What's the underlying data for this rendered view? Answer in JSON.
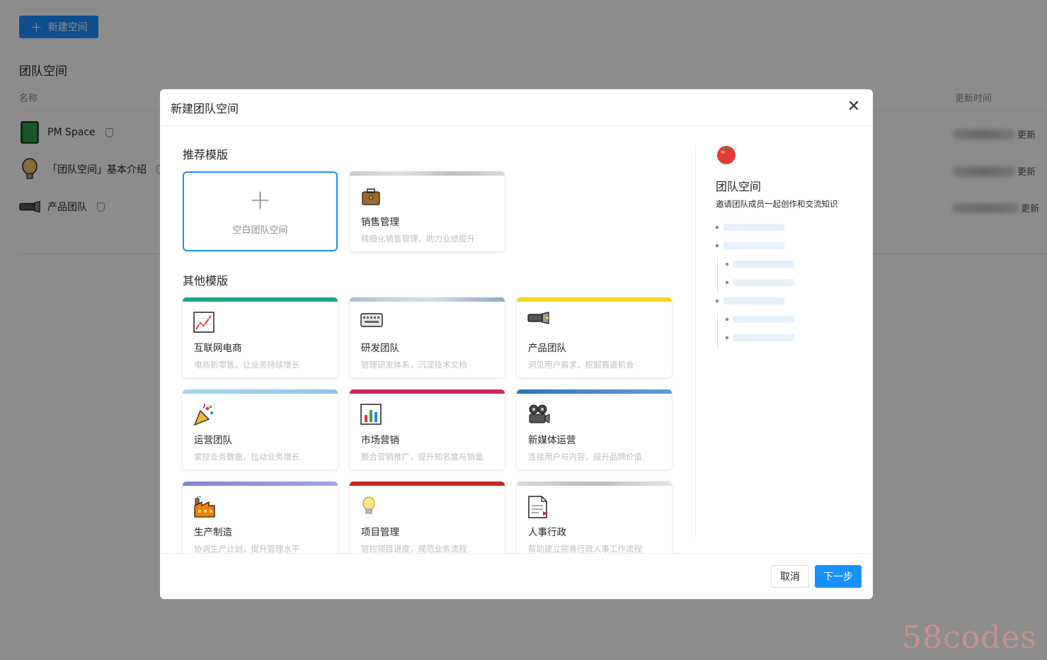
{
  "background": {
    "new_space_button": "新建空间",
    "section_title": "团队空间",
    "column_name": "名称",
    "column_updated": "更新时间",
    "spaces": [
      {
        "name": "PM Space",
        "icon": "green-book-icon",
        "time_suffix": "更新"
      },
      {
        "name": "「团队空间」基本介绍",
        "icon": "light-bulb-icon",
        "time_suffix": "更新"
      },
      {
        "name": "产品团队",
        "icon": "flashlight-icon",
        "time_suffix": "更新"
      }
    ]
  },
  "modal": {
    "title": "新建团队空间",
    "recommended_title": "推荐模版",
    "other_title": "其他模版",
    "blank_card": {
      "label": "空白团队空间"
    },
    "recommended": [
      {
        "title": "销售管理",
        "desc": "精细化销售管理，助力业绩提升",
        "icon": "briefcase-icon",
        "band": "#cfcfcf"
      }
    ],
    "templates": [
      {
        "title": "互联网电商",
        "desc": "电商新零售，让业务持续增长",
        "icon": "chart-increasing-icon",
        "band": "#1aa68e"
      },
      {
        "title": "研发团队",
        "desc": "管理研发体系，沉淀技术文档",
        "icon": "keyboard-icon",
        "band": "#8fa9c9"
      },
      {
        "title": "产品团队",
        "desc": "洞见用户需求，挖掘赛道机会",
        "icon": "flashlight-icon",
        "band": "#f5d51b"
      },
      {
        "title": "运营团队",
        "desc": "掌控业务数据，拉动业务增长",
        "icon": "party-popper-icon",
        "band": "#8ec4e6"
      },
      {
        "title": "市场营销",
        "desc": "整合营销推广，提升知名度与销量",
        "icon": "bar-chart-icon",
        "band": "#c8285b"
      },
      {
        "title": "新媒体运营",
        "desc": "连接用户与内容，提升品牌价值",
        "icon": "film-projector-icon",
        "band": "#3f86c6"
      },
      {
        "title": "生产制造",
        "desc": "协调生产计划，提升管理水平",
        "icon": "factory-icon",
        "band": "#7b86d6"
      },
      {
        "title": "项目管理",
        "desc": "管控项目进度，规范业务流程",
        "icon": "light-bulb-icon",
        "band": "#c0291f"
      },
      {
        "title": "人事行政",
        "desc": "帮助建立完善行政人事工作流程",
        "icon": "document-icon",
        "band": "#cfcfcf"
      }
    ],
    "preview": {
      "icon": "tomato-icon",
      "title": "团队空间",
      "desc": "邀请团队成员一起创作和交流知识"
    },
    "cancel_label": "取消",
    "next_label": "下一步"
  },
  "watermark": "58codes",
  "colors": {
    "primary": "#1890ff",
    "overlay": "rgba(0,0,0,0.45)"
  }
}
